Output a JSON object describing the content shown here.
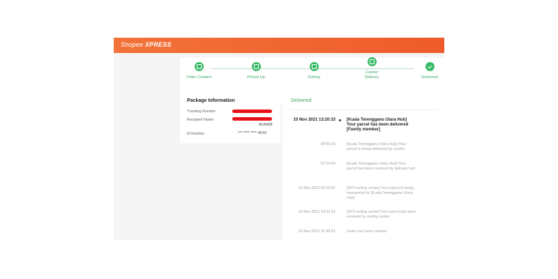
{
  "header": {
    "logo_shopee": "Shopee",
    "logo_xpress": "XPRESS"
  },
  "steps": [
    {
      "label": "Order Created"
    },
    {
      "label": "Picked Up"
    },
    {
      "label": "Sorting"
    },
    {
      "label": "Courier Delivery"
    },
    {
      "label": "Delivered"
    }
  ],
  "package": {
    "title": "Package Information",
    "tracking_label": "Tracking Number",
    "recipient_label": "Recipient Name",
    "recipient_suffix": "AUNAN",
    "id_label": "Id Number",
    "id_value": "*** **** **** 4615"
  },
  "timeline": {
    "status": "Delivered",
    "events": [
      {
        "time": "10 Nov 2021 13:20:33",
        "desc": "[Kuala Terengganu Utara Hub] Your parcel has been delivered [Family member]"
      },
      {
        "time": "09:59:23",
        "desc": "[Kuala Terengganu Utara Hub] Your parcel is being delivered by courier"
      },
      {
        "time": "07:14:02",
        "desc": "[Kuala Terengganu Utara Hub] Your parcel has been received by delivery hub"
      },
      {
        "time": "10 Nov 2021 02:23:47",
        "desc": "[SP3 sorting center] Your parcel is being transported to [Kuala Terengganu Utara Hub]"
      },
      {
        "time": "10 Nov 2021 14:31:21",
        "desc": "[SP3 sorting center] Your parcel has been received by sorting center"
      },
      {
        "time": "10 Nov 2021 21:49:51",
        "desc": "Order has been created"
      }
    ]
  }
}
